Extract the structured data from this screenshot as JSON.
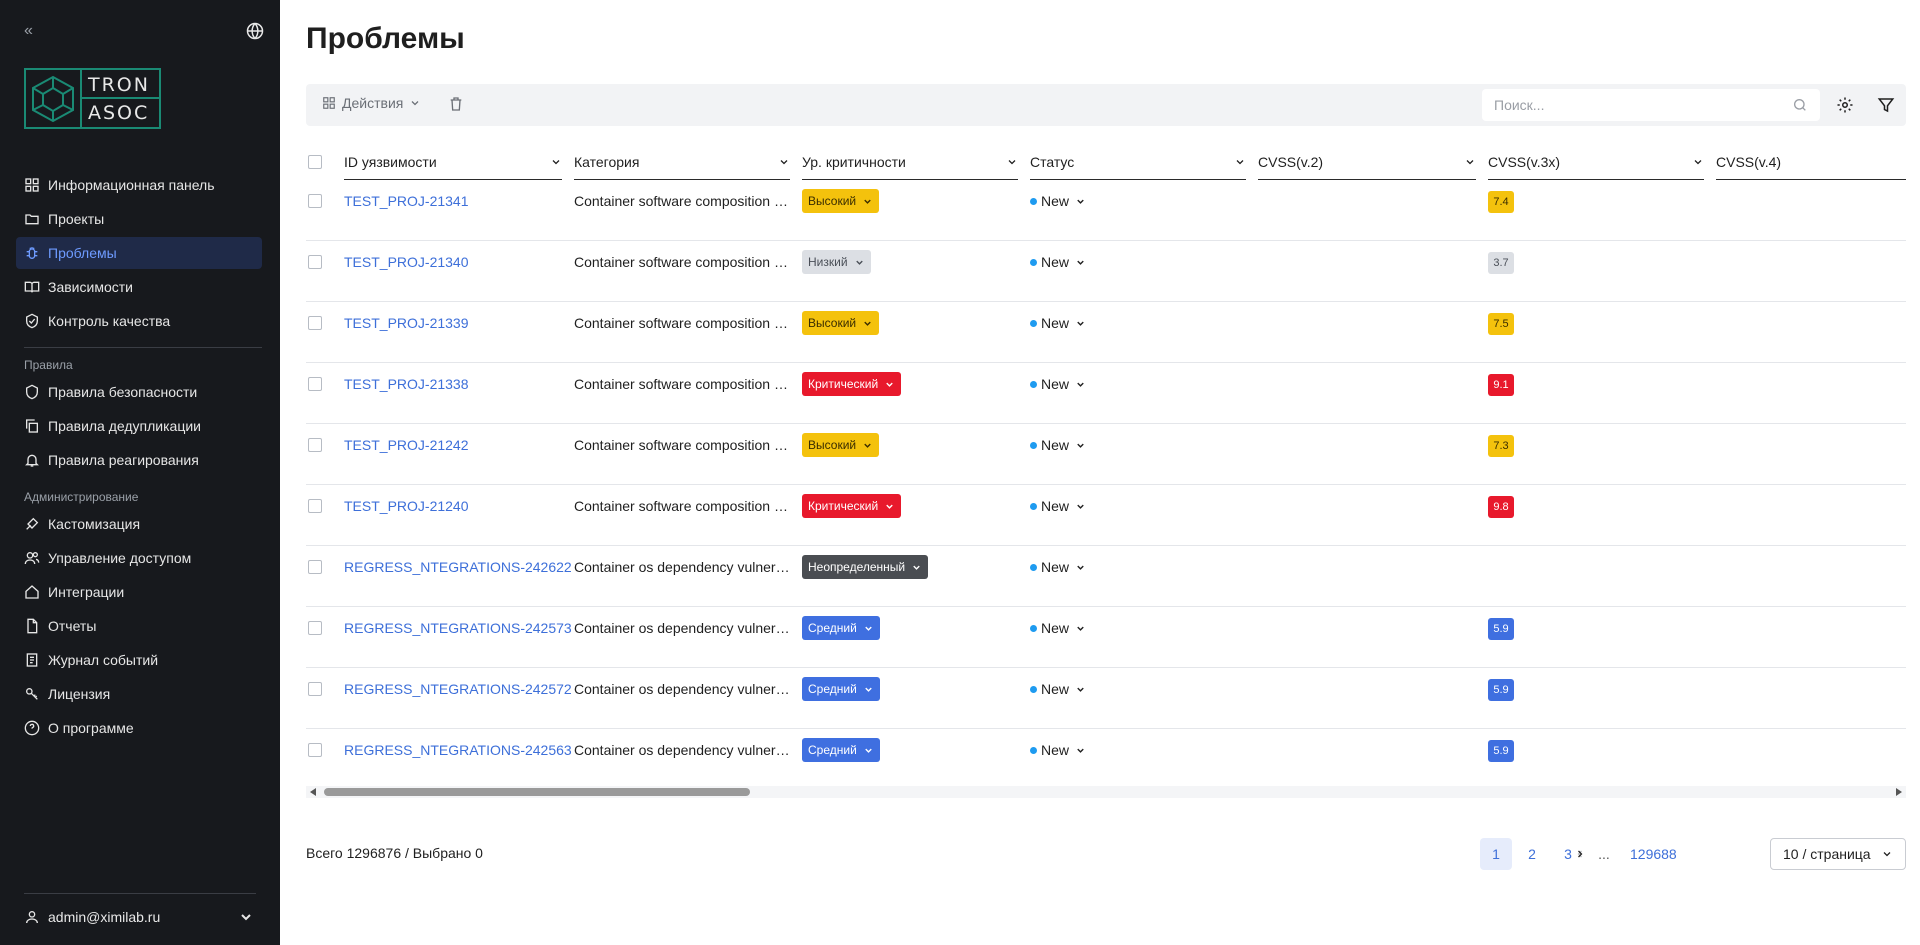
{
  "sidebar": {
    "logo": {
      "line1": "TRON",
      "line2": "ASOC"
    },
    "items": [
      {
        "label": "Информационная панель",
        "icon": "dashboard-icon"
      },
      {
        "label": "Проекты",
        "icon": "folder-icon"
      },
      {
        "label": "Проблемы",
        "icon": "bug-icon",
        "active": true
      },
      {
        "label": "Зависимости",
        "icon": "book-icon"
      },
      {
        "label": "Контроль качества",
        "icon": "shield-check-icon"
      }
    ],
    "section_rules": "Правила",
    "rules_items": [
      {
        "label": "Правила безопасности",
        "icon": "shield-icon"
      },
      {
        "label": "Правила дедупликации",
        "icon": "copy-icon"
      },
      {
        "label": "Правила реагирования",
        "icon": "bell-icon"
      }
    ],
    "section_admin": "Администрирование",
    "admin_items": [
      {
        "label": "Кастомизация",
        "icon": "palette-icon"
      },
      {
        "label": "Управление доступом",
        "icon": "users-icon"
      },
      {
        "label": "Интеграции",
        "icon": "home-icon"
      },
      {
        "label": "Отчеты",
        "icon": "file-icon"
      },
      {
        "label": "Журнал событий",
        "icon": "log-icon"
      },
      {
        "label": "Лицензия",
        "icon": "key-icon"
      },
      {
        "label": "О программе",
        "icon": "help-icon"
      }
    ],
    "user": "admin@ximilab.ru"
  },
  "page": {
    "title": "Проблемы"
  },
  "toolbar": {
    "actions_label": "Действия",
    "search_placeholder": "Поиск..."
  },
  "table": {
    "columns": [
      "ID уязвимости",
      "Категория",
      "Ур. критичности",
      "Статус",
      "CVSS(v.2)",
      "CVSS(v.3x)",
      "CVSS(v.4)"
    ],
    "rows": [
      {
        "id": "TEST_PROJ-21341",
        "category": "Container software composition analysis",
        "severity": "Высокий",
        "sev": "high",
        "status": "New",
        "cvss3": "7.4"
      },
      {
        "id": "TEST_PROJ-21340",
        "category": "Container software composition analysis",
        "severity": "Низкий",
        "sev": "low",
        "status": "New",
        "cvss3": "3.7"
      },
      {
        "id": "TEST_PROJ-21339",
        "category": "Container software composition analysis",
        "severity": "Высокий",
        "sev": "high",
        "status": "New",
        "cvss3": "7.5"
      },
      {
        "id": "TEST_PROJ-21338",
        "category": "Container software composition analysis",
        "severity": "Критический",
        "sev": "critical",
        "status": "New",
        "cvss3": "9.1"
      },
      {
        "id": "TEST_PROJ-21242",
        "category": "Container software composition analysis",
        "severity": "Высокий",
        "sev": "high",
        "status": "New",
        "cvss3": "7.3"
      },
      {
        "id": "TEST_PROJ-21240",
        "category": "Container software composition analysis",
        "severity": "Критический",
        "sev": "critical",
        "status": "New",
        "cvss3": "9.8"
      },
      {
        "id": "REGRESS_NTEGRATIONS-242622",
        "category": "Container os dependency vulnerability",
        "severity": "Неопределенный",
        "sev": "undefined",
        "status": "New",
        "cvss3": ""
      },
      {
        "id": "REGRESS_NTEGRATIONS-242573",
        "category": "Container os dependency vulnerability",
        "severity": "Средний",
        "sev": "medium",
        "status": "New",
        "cvss3": "5.9"
      },
      {
        "id": "REGRESS_NTEGRATIONS-242572",
        "category": "Container os dependency vulnerability",
        "severity": "Средний",
        "sev": "medium",
        "status": "New",
        "cvss3": "5.9"
      },
      {
        "id": "REGRESS_NTEGRATIONS-242563",
        "category": "Container os dependency vulnerability",
        "severity": "Средний",
        "sev": "medium",
        "status": "New",
        "cvss3": "5.9"
      }
    ]
  },
  "severity_colors": {
    "critical": {
      "bg": "#e8192c",
      "fg": "#ffffff"
    },
    "high": {
      "bg": "#f4c20d",
      "fg": "#3a2d00"
    },
    "medium": {
      "bg": "#3f6fe0",
      "fg": "#ffffff"
    },
    "low": {
      "bg": "#dcdfe4",
      "fg": "#4a4f57"
    },
    "undefined": {
      "bg": "#4a4d52",
      "fg": "#ffffff"
    }
  },
  "footer": {
    "total_text": "Всего 1296876 / Выбрано 0",
    "pages": [
      "1",
      "2",
      "3",
      "...",
      "129688"
    ],
    "current_page": "1",
    "per_page": "10 / страница"
  }
}
